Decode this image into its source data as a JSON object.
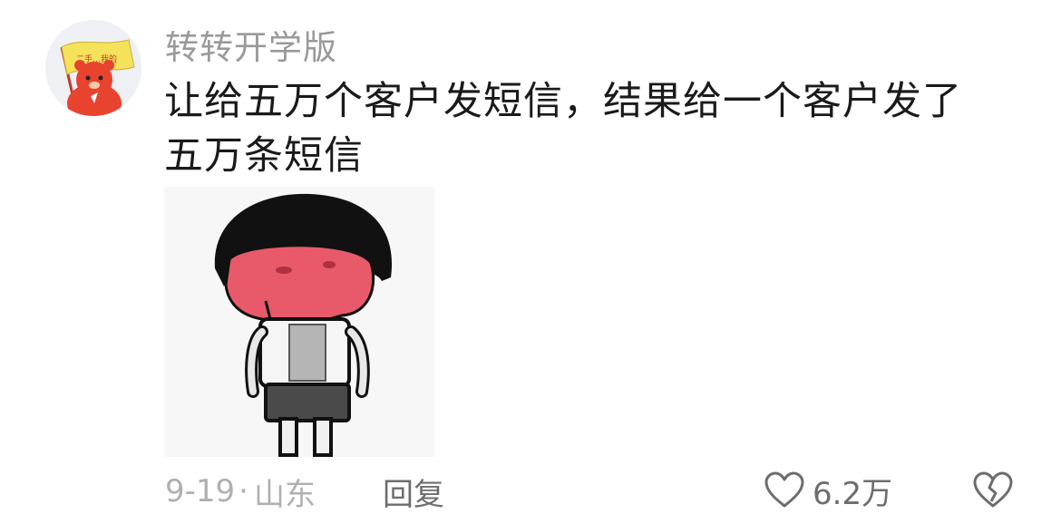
{
  "comment": {
    "username": "转转开学版",
    "text_lines": [
      "让给五万个客户发短信，结果给一个客户发了",
      "五万条短信"
    ],
    "date": "9-19",
    "separator": "·",
    "location": "山东",
    "reply_label": "回复",
    "like_count": "6.2万"
  },
  "avatar": {
    "flag_text": "二手…我的",
    "flag_color": "#f5e15a",
    "character_color": "#e8432f"
  },
  "sticker": {
    "icon": "red-face-cartoon-boy-sticker",
    "face_color": "#e85a6a"
  },
  "icons": {
    "like": "heart-outline-icon",
    "dislike": "broken-heart-icon"
  }
}
